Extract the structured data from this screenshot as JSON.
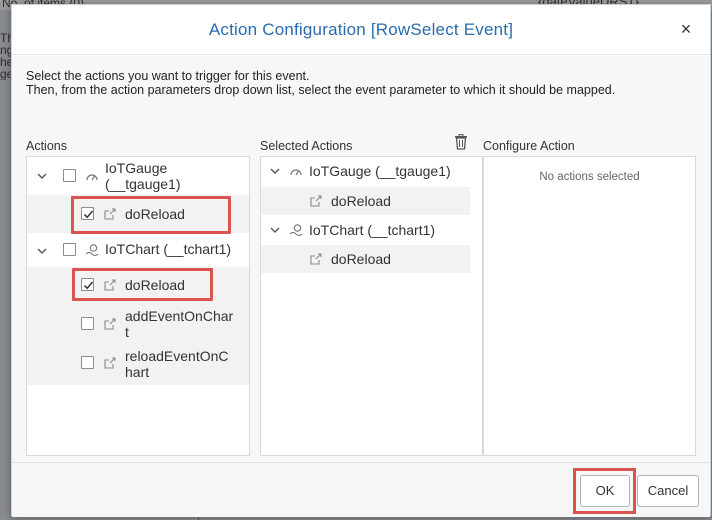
{
  "background": {
    "text_left": "No. of items (0)",
    "text_left2": "Th ng he ge",
    "text_right": "{dateValueDRS1}"
  },
  "dialog": {
    "title": "Action Configuration [RowSelect Event]",
    "close_label": "×",
    "intro_line1": "Select the actions you want to trigger for this event.",
    "intro_line2": "Then, from the action parameters drop down list, select the event parameter to which it should be mapped.",
    "actions_label": "Actions",
    "selected_label": "Selected Actions",
    "configure_label": "Configure Action",
    "no_actions": "No actions selected",
    "ok_label": "OK",
    "cancel_label": "Cancel"
  },
  "actions_tree": {
    "gauge": {
      "label_line1": "IoTGauge",
      "label_line2": "(__tgauge1)",
      "expanded": true,
      "checked": false
    },
    "gauge_doReload": {
      "label": "doReload",
      "checked": true
    },
    "chart": {
      "label": "IoTChart (__tchart1)",
      "expanded": true,
      "checked": false
    },
    "chart_doReload": {
      "label": "doReload",
      "checked": true
    },
    "chart_addEvent": {
      "label_line1": "addEventOnChar",
      "label_line2": "t",
      "checked": false
    },
    "chart_reloadEvent": {
      "label_line1": "reloadEventOnC",
      "label_line2": "hart",
      "checked": false
    }
  },
  "selected_tree": {
    "gauge": {
      "label": "IoTGauge (__tgauge1)"
    },
    "gauge_doReload": {
      "label": "doReload"
    },
    "chart": {
      "label": "IoTChart (__tchart1)"
    },
    "chart_doReload": {
      "label": "doReload"
    }
  },
  "colors": {
    "title_blue": "#2a6bb0",
    "highlight_red": "#d9534f"
  }
}
